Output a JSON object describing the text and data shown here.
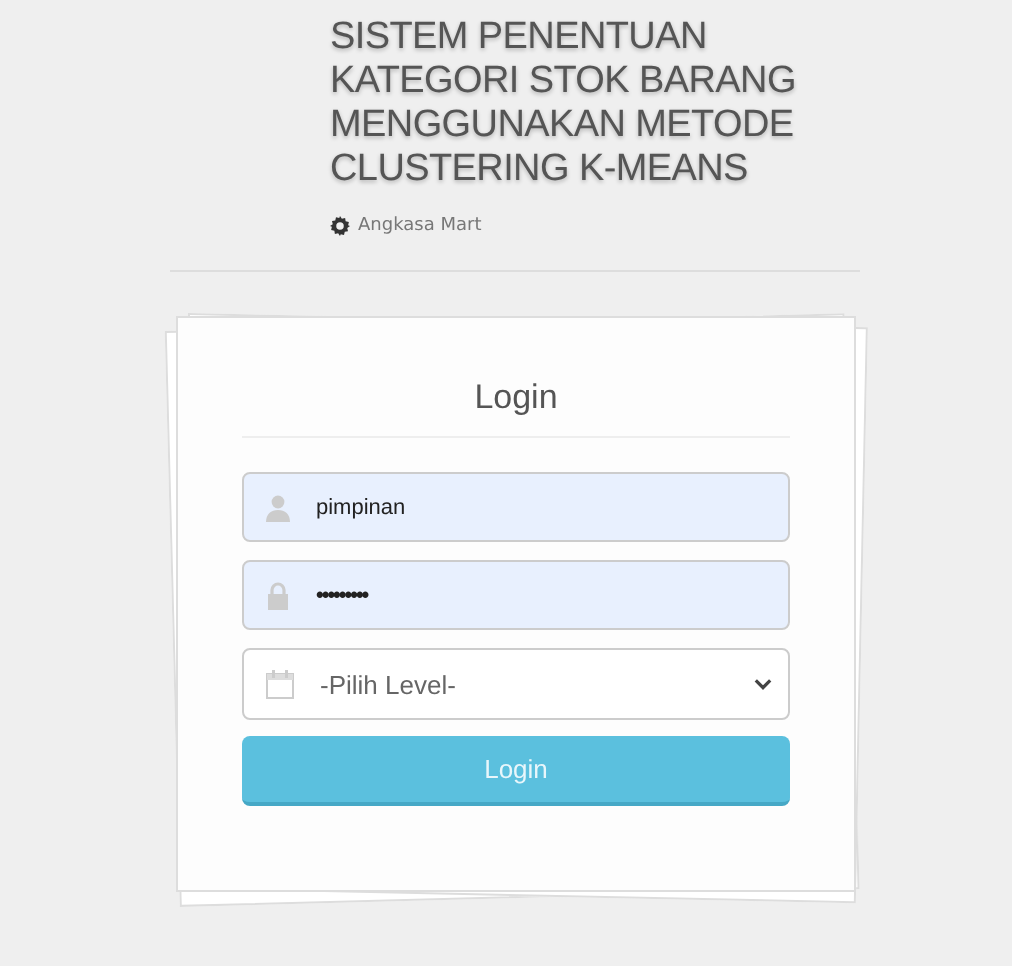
{
  "header": {
    "title": "SISTEM PENENTUAN KATEGORI STOK BARANG MENGGUNAKAN METODE CLUSTERING K-MEANS",
    "subtitle": "Angkasa Mart"
  },
  "login": {
    "heading": "Login",
    "fields": [
      {
        "kind": "user",
        "value": "pimpinan"
      },
      {
        "kind": "password",
        "value": "•••••••••"
      }
    ],
    "level_select": {
      "placeholder": "-Pilih Level-"
    },
    "button": "Login"
  }
}
